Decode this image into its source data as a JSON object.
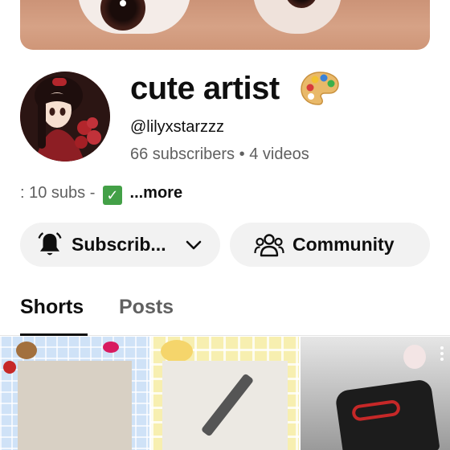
{
  "channel": {
    "name": "cute artist",
    "name_icon": "artist-palette-emoji",
    "handle": "@lilyxstarzzz",
    "subscribers": "66 subscribers",
    "separator": "•",
    "videos": "4 videos"
  },
  "description": {
    "prefix": ": 10 subs -",
    "emoji": "✓",
    "emoji_icon": "check-mark-button-emoji",
    "more": "...more"
  },
  "actions": {
    "subscribe_label": "Subscrib...",
    "subscribe_icon": "bell-icon",
    "dropdown_icon": "chevron-down-icon",
    "community_label": "Community",
    "community_icon": "people-icon"
  },
  "tabs": [
    {
      "label": "Shorts",
      "selected": true
    },
    {
      "label": "Posts",
      "selected": false
    }
  ],
  "colors": {
    "text_primary": "#0f0f0f",
    "text_secondary": "#606060",
    "pill_background": "#f2f2f2",
    "check_green": "#43a047"
  },
  "shorts_grid": [
    {
      "thumbnail": "pencil sketch on blue gingham background"
    },
    {
      "thumbnail": "drawing with pen on yellow checkered background"
    },
    {
      "thumbnail": "black pencil case with red eyes"
    }
  ]
}
